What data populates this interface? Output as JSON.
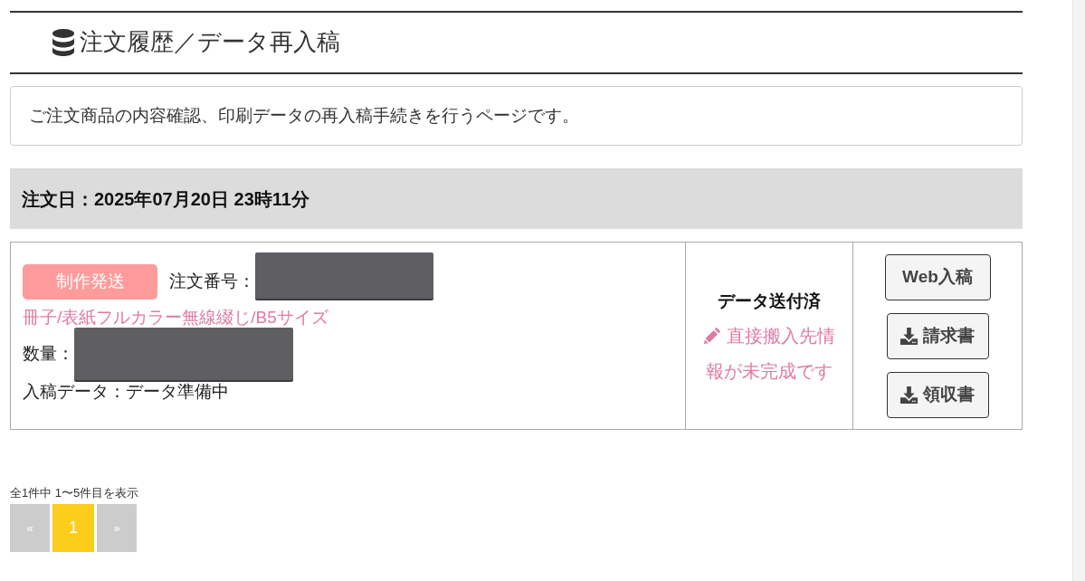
{
  "page_title": "注文履歴／データ再入稿",
  "description": "ご注文商品の内容確認、印刷データの再入稿手続きを行うページです。",
  "orders": [
    {
      "date": "注文日：2025年07月20日 23時11分",
      "status_badge": "制作発送",
      "order_number": {
        "label": "注文番号：",
        "redacted": true
      },
      "product": "冊子/表紙フルカラー無線綴じ/B5サイズ",
      "quantity": {
        "label": "数量：",
        "redacted": true
      },
      "data_status": "入稿データ：データ準備中",
      "send_status": "データ送付済",
      "notice": "直接搬入先情報が未完成です",
      "buttons": [
        {
          "label": "Web入稿",
          "kind": "plain"
        },
        {
          "label": "請求書",
          "kind": "download"
        },
        {
          "label": "領収書",
          "kind": "download"
        }
      ]
    }
  ],
  "pagination": {
    "summary": "全1件中 1〜5件目を表示",
    "pages": [
      {
        "label": "«",
        "selected": false
      },
      {
        "label": "1",
        "selected": true
      },
      {
        "label": "»",
        "selected": false
      }
    ]
  }
}
